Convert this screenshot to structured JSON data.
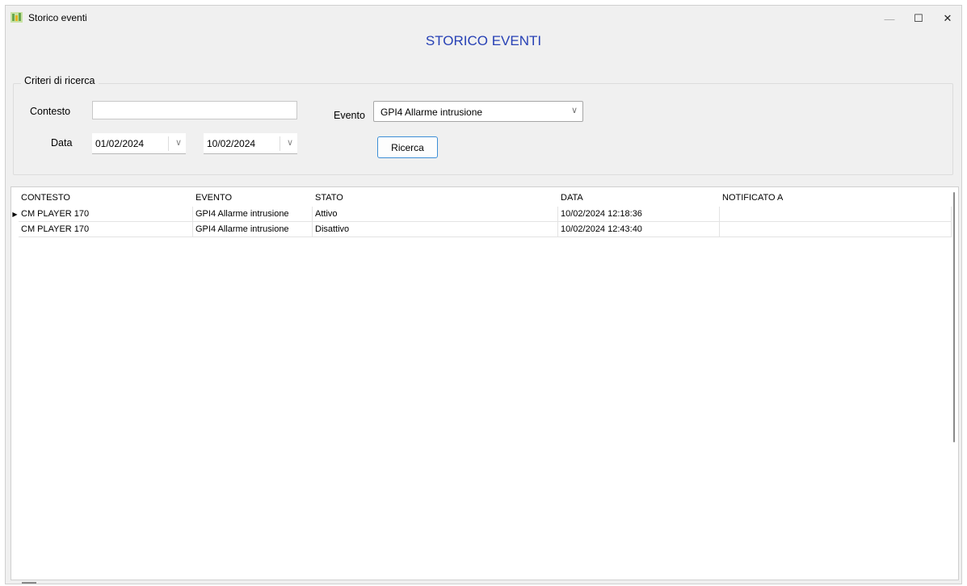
{
  "window": {
    "title": "Storico eventi",
    "controls": {
      "minimize": "—",
      "maximize": "☐",
      "close": "✕"
    }
  },
  "heading": "STORICO EVENTI",
  "search": {
    "group_title": "Criteri di ricerca",
    "contesto_label": "Contesto",
    "contesto_value": "",
    "data_label": "Data",
    "date_from": "01/02/2024",
    "date_to": "10/02/2024",
    "evento_label": "Evento",
    "evento_value": "GPI4 Allarme intrusione",
    "search_button": "Ricerca"
  },
  "grid": {
    "columns": [
      "CONTESTO",
      "EVENTO",
      "STATO",
      "DATA",
      "NOTIFICATO A"
    ],
    "rows": [
      [
        "CM PLAYER 170",
        "GPI4 Allarme intrusione",
        "Attivo",
        "10/02/2024 12:18:36",
        ""
      ],
      [
        "CM PLAYER 170",
        "GPI4 Allarme intrusione",
        "Disattivo",
        "10/02/2024 12:43:40",
        ""
      ]
    ],
    "current_row_indicator": "▶"
  },
  "colors": {
    "heading": "#2741b5",
    "button_border": "#3c8ed6",
    "window_bg": "#f0f0f0"
  }
}
